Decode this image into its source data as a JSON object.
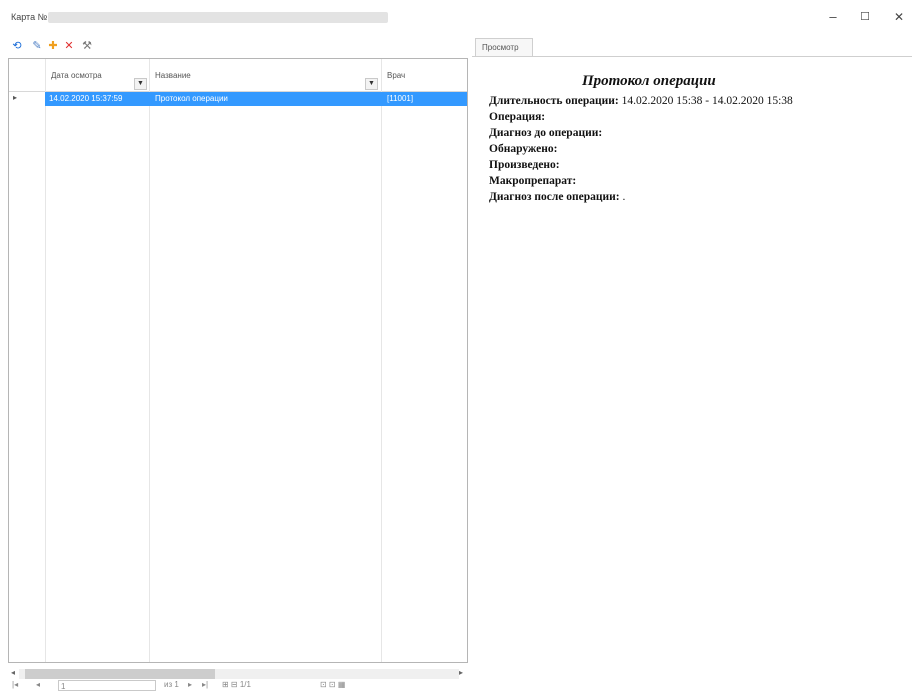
{
  "window": {
    "title": "Карта №",
    "minimize_glyph": "–",
    "maximize_glyph": "☐",
    "close_glyph": "✕"
  },
  "toolbar": {
    "buttons": [
      {
        "icon": "refresh-icon",
        "glyph": "⟲",
        "color": "#1e6fd9"
      },
      {
        "icon": "edit-icon",
        "glyph": "✎",
        "color": "#4d7fc4"
      },
      {
        "icon": "add-icon",
        "glyph": "✚",
        "color": "#f0a020"
      },
      {
        "icon": "delete-icon",
        "glyph": "✕",
        "color": "#e03030"
      },
      {
        "icon": "tools-icon",
        "glyph": "⚒",
        "color": "#777777"
      }
    ]
  },
  "grid": {
    "columns": [
      "Дата осмотра",
      "Название",
      "Врач"
    ],
    "filter_glyph": "▼",
    "rows": [
      {
        "date": "14.02.2020 15:37:59",
        "name": "Протокол операции",
        "doctor": "[11001]",
        "selected": true
      }
    ],
    "row_indicator": "▸",
    "selection_color": "#3399ff"
  },
  "scrollbar": {
    "left_glyph": "◂",
    "right_glyph": "▸"
  },
  "pager": {
    "first": "|◂",
    "prev": "◂",
    "page_value": "1",
    "of_label": "из 1",
    "next": "▸",
    "last": "▸|",
    "tail": "⊞  ⊟  1/1",
    "tail2": "⊡  ⊡  ▦"
  },
  "viewer": {
    "tab_label": "Просмотр",
    "title": "Протокол операции",
    "fields": [
      {
        "label": "Длительность операции:",
        "value": " 14.02.2020 15:38 - 14.02.2020 15:38"
      },
      {
        "label": "Операция:",
        "value": ""
      },
      {
        "label": "Диагноз до операции:",
        "value": ""
      },
      {
        "label": "Обнаружено:",
        "value": ""
      },
      {
        "label": "Произведено:",
        "value": ""
      },
      {
        "label": "Макропрепарат:",
        "value": ""
      },
      {
        "label": "Диагноз после операции:",
        "value": " ."
      }
    ]
  }
}
